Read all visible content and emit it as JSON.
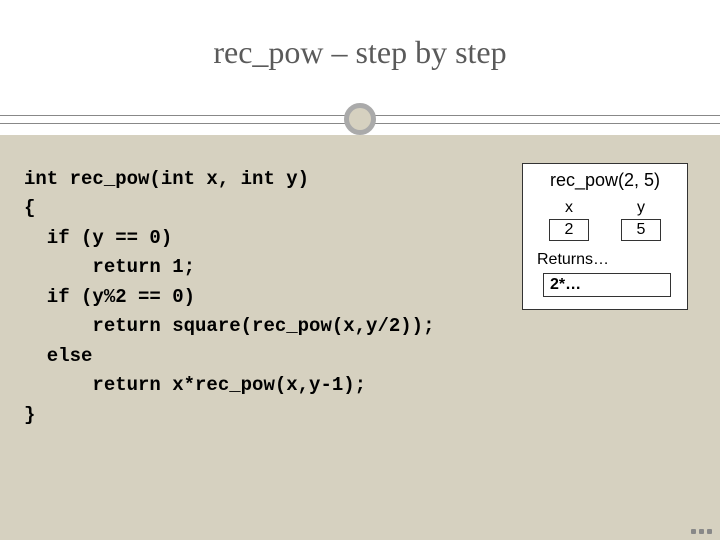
{
  "title": "rec_pow – step by step",
  "code": "int rec_pow(int x, int y)\n{\n  if (y == 0)\n      return 1;\n  if (y%2 == 0)\n      return square(rec_pow(x,y/2));\n  else\n      return x*rec_pow(x,y-1);\n}",
  "trace": {
    "call": "rec_pow(2, 5)",
    "vars": [
      {
        "name": "x",
        "value": "2"
      },
      {
        "name": "y",
        "value": "5"
      }
    ],
    "returns_label": "Returns…",
    "returns_value": "2*…"
  }
}
